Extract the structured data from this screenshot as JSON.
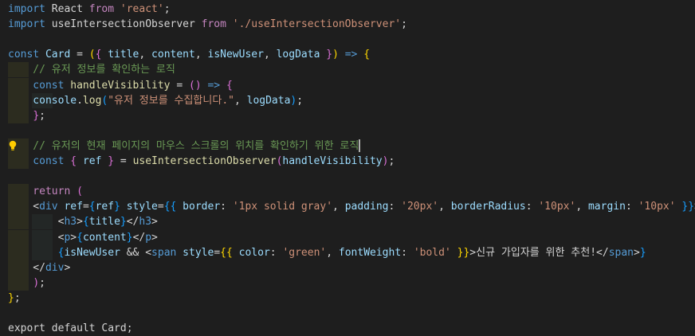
{
  "editor": {
    "lines": [
      [
        {
          "t": "import",
          "c": "kw"
        },
        {
          "t": " React ",
          "c": "text"
        },
        {
          "t": "from",
          "c": "ctrl"
        },
        {
          "t": " 'react'",
          "c": "str"
        },
        {
          "t": ";",
          "c": "punc"
        }
      ],
      [
        {
          "t": "import",
          "c": "kw"
        },
        {
          "t": " useIntersectionObserver ",
          "c": "text"
        },
        {
          "t": "from",
          "c": "ctrl"
        },
        {
          "t": " './useIntersectionObserver'",
          "c": "str"
        },
        {
          "t": ";",
          "c": "punc"
        }
      ],
      [],
      [
        {
          "t": "const",
          "c": "kw"
        },
        {
          "t": " Card",
          "c": "var"
        },
        {
          "t": " = ",
          "c": "punc"
        },
        {
          "t": "(",
          "c": "brace"
        },
        {
          "t": "{",
          "c": "brace2"
        },
        {
          "t": " title",
          "c": "var"
        },
        {
          "t": ", ",
          "c": "punc"
        },
        {
          "t": "content",
          "c": "var"
        },
        {
          "t": ", ",
          "c": "punc"
        },
        {
          "t": "isNewUser",
          "c": "var"
        },
        {
          "t": ", ",
          "c": "punc"
        },
        {
          "t": "logData",
          "c": "var"
        },
        {
          "t": " }",
          "c": "brace2"
        },
        {
          "t": ")",
          "c": "brace"
        },
        {
          "t": " => ",
          "c": "kw"
        },
        {
          "t": "{",
          "c": "brace"
        }
      ],
      [
        {
          "t": "    // 유저 정보를 확인하는 로직",
          "c": "comment"
        }
      ],
      [
        {
          "t": "    const",
          "c": "kw"
        },
        {
          "t": " handleVisibility",
          "c": "fn"
        },
        {
          "t": " = ",
          "c": "punc"
        },
        {
          "t": "()",
          "c": "brace2"
        },
        {
          "t": " => ",
          "c": "kw"
        },
        {
          "t": "{",
          "c": "brace2"
        }
      ],
      [
        {
          "t": "    console",
          "c": "var"
        },
        {
          "t": ".",
          "c": "punc"
        },
        {
          "t": "log",
          "c": "fn"
        },
        {
          "t": "(",
          "c": "brace3"
        },
        {
          "t": "\"유저 정보를 수집합니다.\"",
          "c": "str"
        },
        {
          "t": ", ",
          "c": "punc"
        },
        {
          "t": "logData",
          "c": "var"
        },
        {
          "t": ")",
          "c": "brace3"
        },
        {
          "t": ";",
          "c": "punc"
        }
      ],
      [
        {
          "t": "    ",
          "c": "text"
        },
        {
          "t": "}",
          "c": "brace2"
        },
        {
          "t": ";",
          "c": "punc"
        }
      ],
      [],
      [
        {
          "t": "    // 유저의 현재 페이지의 마우스 스크롤의 위치를 확인하기 위한 로직",
          "c": "comment"
        }
      ],
      [
        {
          "t": "    const",
          "c": "kw"
        },
        {
          "t": " { ",
          "c": "brace2"
        },
        {
          "t": "ref",
          "c": "var"
        },
        {
          "t": " }",
          "c": "brace2"
        },
        {
          "t": " = ",
          "c": "punc"
        },
        {
          "t": "useIntersectionObserver",
          "c": "fn"
        },
        {
          "t": "(",
          "c": "brace2"
        },
        {
          "t": "handleVisibility",
          "c": "var"
        },
        {
          "t": ")",
          "c": "brace2"
        },
        {
          "t": ";",
          "c": "punc"
        }
      ],
      [],
      [
        {
          "t": "    return",
          "c": "ctrl"
        },
        {
          "t": " (",
          "c": "brace2"
        }
      ],
      [
        {
          "t": "    <",
          "c": "punc"
        },
        {
          "t": "div",
          "c": "tag"
        },
        {
          "t": " ref",
          "c": "attr"
        },
        {
          "t": "=",
          "c": "punc"
        },
        {
          "t": "{",
          "c": "brace3"
        },
        {
          "t": "ref",
          "c": "var"
        },
        {
          "t": "}",
          "c": "brace3"
        },
        {
          "t": " style",
          "c": "attr"
        },
        {
          "t": "=",
          "c": "punc"
        },
        {
          "t": "{{",
          "c": "brace3"
        },
        {
          "t": " border",
          "c": "var"
        },
        {
          "t": ": ",
          "c": "punc"
        },
        {
          "t": "'1px solid gray'",
          "c": "str"
        },
        {
          "t": ", ",
          "c": "punc"
        },
        {
          "t": "padding",
          "c": "var"
        },
        {
          "t": ": ",
          "c": "punc"
        },
        {
          "t": "'20px'",
          "c": "str"
        },
        {
          "t": ", ",
          "c": "punc"
        },
        {
          "t": "borderRadius",
          "c": "var"
        },
        {
          "t": ": ",
          "c": "punc"
        },
        {
          "t": "'10px'",
          "c": "str"
        },
        {
          "t": ", ",
          "c": "punc"
        },
        {
          "t": "margin",
          "c": "var"
        },
        {
          "t": ": ",
          "c": "punc"
        },
        {
          "t": "'10px'",
          "c": "str"
        },
        {
          "t": " }}",
          "c": "brace3"
        },
        {
          "t": ">",
          "c": "punc"
        }
      ],
      [
        {
          "t": "        <",
          "c": "punc"
        },
        {
          "t": "h3",
          "c": "tag"
        },
        {
          "t": ">",
          "c": "punc"
        },
        {
          "t": "{",
          "c": "brace3"
        },
        {
          "t": "title",
          "c": "var"
        },
        {
          "t": "}",
          "c": "brace3"
        },
        {
          "t": "</",
          "c": "punc"
        },
        {
          "t": "h3",
          "c": "tag"
        },
        {
          "t": ">",
          "c": "punc"
        }
      ],
      [
        {
          "t": "        <",
          "c": "punc"
        },
        {
          "t": "p",
          "c": "tag"
        },
        {
          "t": ">",
          "c": "punc"
        },
        {
          "t": "{",
          "c": "brace3"
        },
        {
          "t": "content",
          "c": "var"
        },
        {
          "t": "}",
          "c": "brace3"
        },
        {
          "t": "</",
          "c": "punc"
        },
        {
          "t": "p",
          "c": "tag"
        },
        {
          "t": ">",
          "c": "punc"
        }
      ],
      [
        {
          "t": "        {",
          "c": "brace3"
        },
        {
          "t": "isNewUser",
          "c": "var"
        },
        {
          "t": " && ",
          "c": "punc"
        },
        {
          "t": "<",
          "c": "punc"
        },
        {
          "t": "span",
          "c": "tag"
        },
        {
          "t": " style",
          "c": "attr"
        },
        {
          "t": "=",
          "c": "punc"
        },
        {
          "t": "{{",
          "c": "brace"
        },
        {
          "t": " color",
          "c": "var"
        },
        {
          "t": ": ",
          "c": "punc"
        },
        {
          "t": "'green'",
          "c": "str"
        },
        {
          "t": ", ",
          "c": "punc"
        },
        {
          "t": "fontWeight",
          "c": "var"
        },
        {
          "t": ": ",
          "c": "punc"
        },
        {
          "t": "'bold'",
          "c": "str"
        },
        {
          "t": " }}",
          "c": "brace"
        },
        {
          "t": ">",
          "c": "punc"
        },
        {
          "t": "신규 가입자를 위한 추천!",
          "c": "text"
        },
        {
          "t": "</",
          "c": "punc"
        },
        {
          "t": "span",
          "c": "tag"
        },
        {
          "t": ">",
          "c": "punc"
        },
        {
          "t": "}",
          "c": "brace3"
        }
      ],
      [
        {
          "t": "    </",
          "c": "punc"
        },
        {
          "t": "div",
          "c": "tag"
        },
        {
          "t": ">",
          "c": "punc"
        }
      ],
      [
        {
          "t": "    ",
          "c": "text"
        },
        {
          "t": ")",
          "c": "brace2"
        },
        {
          "t": ";",
          "c": "punc"
        }
      ],
      [
        {
          "t": "}",
          "c": "brace"
        },
        {
          "t": ";",
          "c": "punc"
        }
      ],
      [],
      [
        {
          "t": "export default Card;",
          "c": "text"
        }
      ]
    ],
    "colors": {
      "background": "#1e1e1e",
      "keyword": "#569cd6",
      "string": "#ce9178",
      "comment": "#6a9955",
      "function": "#dcdcaa",
      "variable": "#9cdcfe"
    },
    "lightbulb_icon": "lightbulb-icon"
  }
}
